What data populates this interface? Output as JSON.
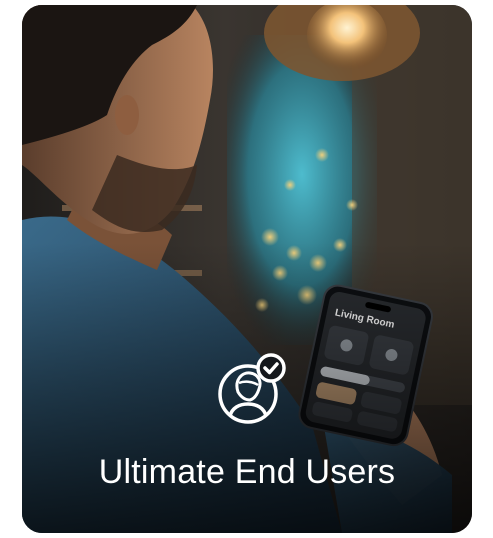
{
  "card": {
    "title": "Ultimate End Users",
    "badge_icon": "user-check-icon",
    "colors": {
      "background": "#14171b",
      "wall_glow": "#3aa6b8",
      "lamp": "#f3c27a",
      "shirt": "#2f5570",
      "text": "#ffffff"
    }
  },
  "phone": {
    "room_title": "Living Room"
  }
}
